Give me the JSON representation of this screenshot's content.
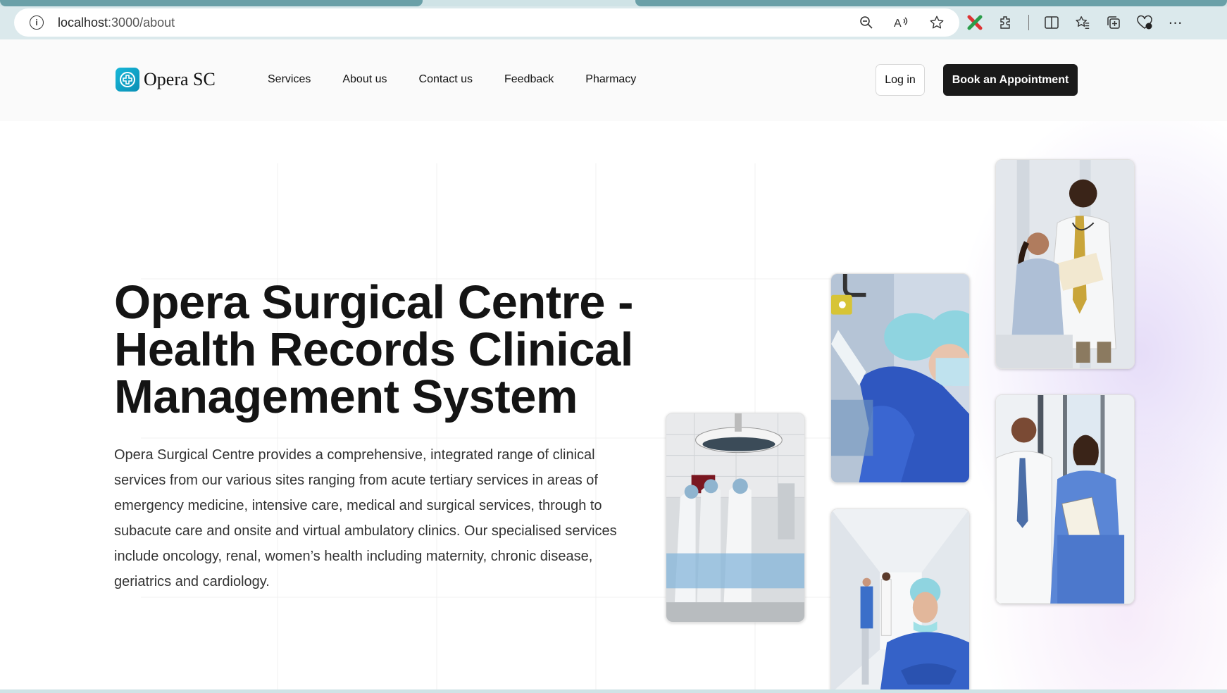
{
  "browser": {
    "url_host": "localhost",
    "url_path": ":3000/about"
  },
  "site": {
    "logo_text": "Opera SC",
    "nav": [
      "Services",
      "About us",
      "Contact us",
      "Feedback",
      "Pharmacy"
    ],
    "login_label": "Log in",
    "book_label": "Book an Appointment"
  },
  "hero": {
    "title": "Opera Surgical Centre - Health Records Clinical Management System",
    "description": "Opera Surgical Centre provides a comprehensive, integrated range of clinical services from our various sites ranging from acute tertiary services in areas of emergency medicine, intensive care, medical and surgical services, through to subacute care and onsite and virtual ambulatory clinics. Our specialised services include oncology, renal, women’s health including maternity, chronic disease, geriatrics and cardiology."
  },
  "photos": [
    {
      "name": "operating-room-photo"
    },
    {
      "name": "surgeon-masked-photo"
    },
    {
      "name": "hospital-corridor-nurse-photo"
    },
    {
      "name": "doctor-patient-photo"
    },
    {
      "name": "doctor-nurse-clipboard-photo"
    }
  ],
  "colors": {
    "brand": "#0a9fc4",
    "button_dark": "#1a1a1a",
    "scrubs": "#3b63c4"
  }
}
